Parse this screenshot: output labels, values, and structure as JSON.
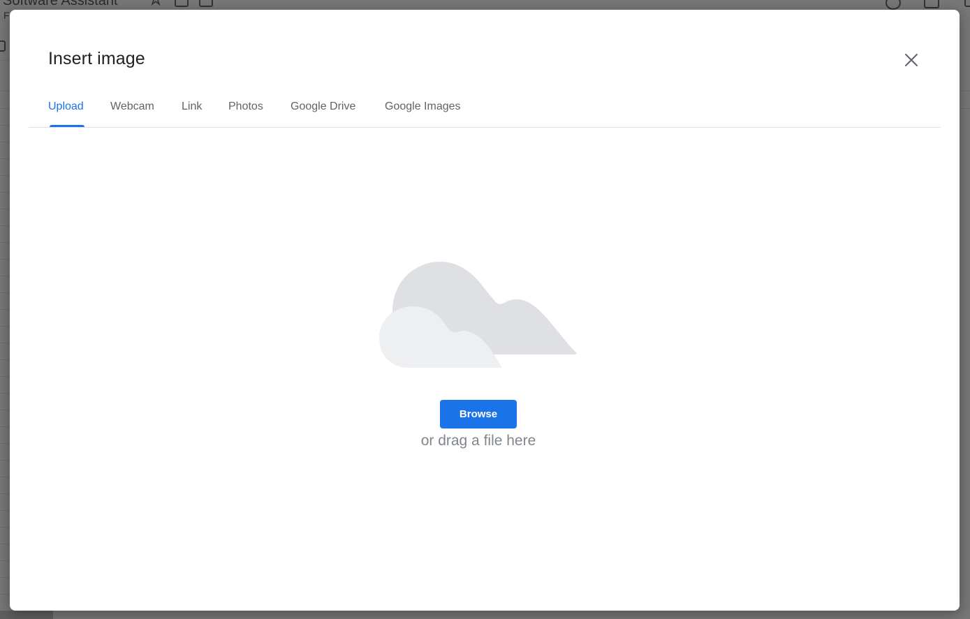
{
  "background": {
    "doc_title": "Software Assistant",
    "menu_letter": "F"
  },
  "dialog": {
    "title": "Insert image",
    "close_icon": "close-icon",
    "tabs": [
      {
        "label": "Upload",
        "active": true
      },
      {
        "label": "Webcam",
        "active": false
      },
      {
        "label": "Link",
        "active": false
      },
      {
        "label": "Photos",
        "active": false
      },
      {
        "label": "Google Drive",
        "active": false
      },
      {
        "label": "Google Images",
        "active": false
      }
    ],
    "illustration_icon": "cloud-illustration-icon",
    "browse_label": "Browse",
    "drag_text": "or drag a file here"
  },
  "colors": {
    "accent": "#1a73e8",
    "title_text": "#202124",
    "tab_text": "#5f6368",
    "hint_text": "#80868b",
    "cloud_back": "#dfe0e3",
    "cloud_front": "#eeeff1"
  }
}
